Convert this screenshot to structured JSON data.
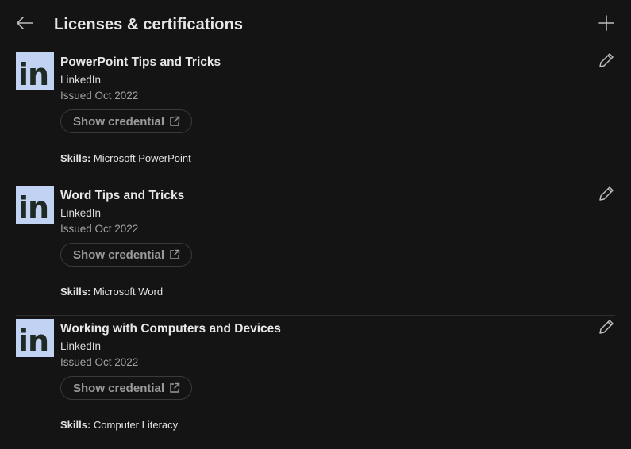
{
  "header": {
    "title": "Licenses & certifications",
    "back_icon": "arrow-left-icon",
    "add_icon": "plus-icon"
  },
  "colors": {
    "background": "#141414",
    "logo_bg": "#c2d2f2",
    "divider": "#2e2e2e"
  },
  "certifications": [
    {
      "logo_text": "in",
      "title": "PowerPoint Tips and Tricks",
      "issuer": "LinkedIn",
      "issued": "Issued Oct 2022",
      "credential_label": "Show credential",
      "skills_label": "Skills:",
      "skills": "Microsoft PowerPoint"
    },
    {
      "logo_text": "in",
      "title": "Word Tips and Tricks",
      "issuer": "LinkedIn",
      "issued": "Issued Oct 2022",
      "credential_label": "Show credential",
      "skills_label": "Skills:",
      "skills": "Microsoft Word"
    },
    {
      "logo_text": "in",
      "title": "Working with Computers and Devices",
      "issuer": "LinkedIn",
      "issued": "Issued Oct 2022",
      "credential_label": "Show credential",
      "skills_label": "Skills:",
      "skills": "Computer Literacy"
    }
  ]
}
